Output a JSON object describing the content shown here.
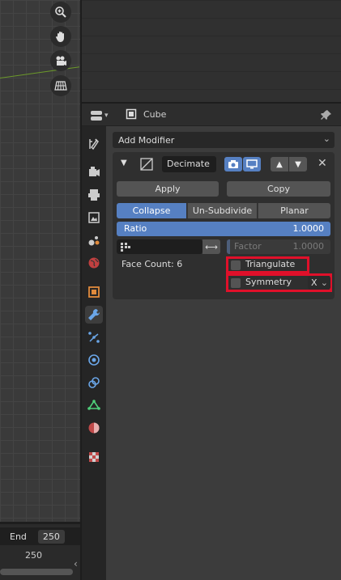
{
  "properties": {
    "object_name": "Cube",
    "add_modifier_label": "Add Modifier",
    "modifier": {
      "name": "Decimate",
      "apply_label": "Apply",
      "copy_label": "Copy",
      "modes": [
        "Collapse",
        "Un-Subdivide",
        "Planar"
      ],
      "active_mode": "Collapse",
      "ratio_label": "Ratio",
      "ratio_value": "1.0000",
      "factor_label": "Factor",
      "factor_value": "1.0000",
      "face_count": "Face Count: 6",
      "triangulate_label": "Triangulate",
      "triangulate_checked": false,
      "symmetry_label": "Symmetry",
      "symmetry_checked": false,
      "symmetry_axis": "X"
    }
  },
  "timeline": {
    "end_label": "End",
    "end_value": "250",
    "current_frame_label": "250"
  },
  "colors": {
    "accent": "#5680c2",
    "highlight_box": "#e0102a"
  },
  "icons": {
    "viewport": [
      "zoom-icon",
      "hand-pan-icon",
      "camera-icon",
      "grid-view-icon"
    ],
    "tabs": [
      "tool-icon",
      "render-icon",
      "output-icon",
      "view-layer-icon",
      "scene-icon",
      "world-icon",
      "object-icon",
      "modifier-wrench-icon",
      "particles-icon",
      "physics-icon",
      "constraints-icon",
      "object-data-icon",
      "material-icon",
      "texture-icon"
    ]
  }
}
